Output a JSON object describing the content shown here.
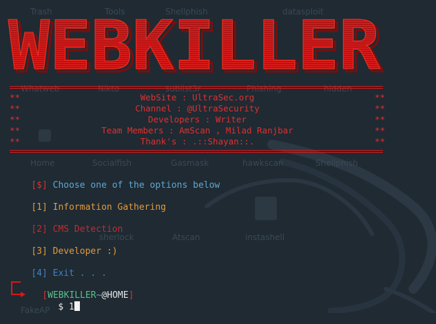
{
  "banner": {
    "text": "WEBKILLER"
  },
  "info": {
    "stars": "**",
    "lines": [
      "WebSite : UltraSec.org",
      "Channel : @UltraSecurity",
      "Developers : Writer",
      "Team Members : AmScan , Milad Ranjbar",
      "Thank's : .::Shayan::."
    ]
  },
  "menu": {
    "choose_bracket": "[$]",
    "choose_text": " Choose one of the options below",
    "items": [
      {
        "key": "[1]",
        "label": " Information Gathering"
      },
      {
        "key": "[2]",
        "label": " CMS Detection"
      },
      {
        "key": "[3]",
        "label": " Developer :)"
      },
      {
        "key": "[4]",
        "label": " Exit . . ."
      }
    ]
  },
  "prompt": {
    "open": "[",
    "name": "WEBKILLER",
    "tilde": "~",
    "host": "@HOME",
    "close": "]",
    "dollar": "$",
    "input": "1"
  },
  "desktop": {
    "icons": [
      "Trash",
      "Tools",
      "Shellphish",
      "Home",
      "Socialfish",
      "Gasmask",
      "hawkscan",
      "Shellphish",
      "Whatweb",
      "Nikto",
      "sublist3r",
      "Phishing",
      "hidden",
      "Atscan",
      "instashell",
      "sherlock",
      "datasploit",
      "FakeAP"
    ]
  },
  "colors": {
    "background": "#1f2a33",
    "banner_red": "#d61a1a",
    "info_red": "#e0302e",
    "prompt_cyan": "#5fa8d3",
    "item_orange": "#e39a3c",
    "item_blue": "#3f82c6",
    "item_dim_red": "#c42b2b",
    "prompt_green": "#58c08a"
  }
}
